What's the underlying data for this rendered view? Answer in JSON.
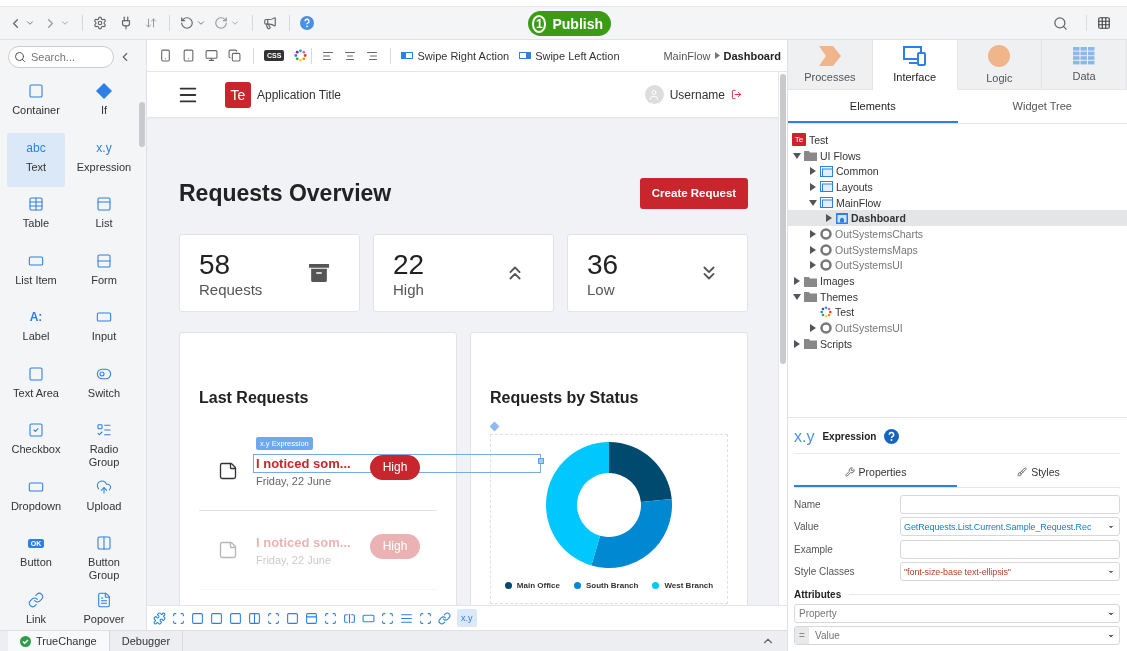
{
  "toolbar": {
    "publish": {
      "step": "1",
      "label": "Publish"
    }
  },
  "widgets": {
    "search": {
      "placeholder": "Search..."
    },
    "items": [
      {
        "label": "Container",
        "kind": "icon",
        "selected": false
      },
      {
        "label": "If",
        "kind": "icon",
        "selected": false
      },
      {
        "label": "Text",
        "kind": "glyph",
        "glyph": "abc",
        "selected": true
      },
      {
        "label": "Expression",
        "kind": "glyph",
        "glyph": "x.y",
        "selected": false
      },
      {
        "label": "Table",
        "kind": "icon",
        "selected": false
      },
      {
        "label": "List",
        "kind": "icon",
        "selected": false
      },
      {
        "label": "List Item",
        "kind": "icon",
        "selected": false
      },
      {
        "label": "Form",
        "kind": "icon",
        "selected": false
      },
      {
        "label": "Label",
        "kind": "glyph",
        "glyph": "A:",
        "selected": false
      },
      {
        "label": "Input",
        "kind": "icon",
        "selected": false
      },
      {
        "label": "Text Area",
        "kind": "icon",
        "selected": false
      },
      {
        "label": "Switch",
        "kind": "icon",
        "selected": false
      },
      {
        "label": "Checkbox",
        "kind": "icon",
        "selected": false
      },
      {
        "label": "Radio Group",
        "kind": "icon",
        "selected": false
      },
      {
        "label": "Dropdown",
        "kind": "icon",
        "selected": false
      },
      {
        "label": "Upload",
        "kind": "icon",
        "selected": false
      },
      {
        "label": "Button",
        "kind": "badge",
        "glyph": "OK",
        "selected": false
      },
      {
        "label": "Button Group",
        "kind": "icon",
        "selected": false
      },
      {
        "label": "Link",
        "kind": "icon",
        "selected": false
      },
      {
        "label": "Popover",
        "kind": "icon",
        "selected": false
      }
    ]
  },
  "canvas_toolbar": {
    "css_label": "CSS",
    "swipe_actions": [
      "Swipe Right Action",
      "Swipe Left Action"
    ],
    "breadcrumb": [
      "MainFlow",
      "Dashboard"
    ]
  },
  "preview": {
    "header": {
      "logo": "Te",
      "app_title": "Application Title",
      "username": "Username"
    },
    "title": "Requests Overview",
    "create_button": "Create Request",
    "stats": [
      {
        "value": "58",
        "label": "Requests"
      },
      {
        "value": "22",
        "label": "High"
      },
      {
        "value": "36",
        "label": "Low"
      }
    ],
    "last_requests": {
      "title": "Last Requests",
      "selection_tag": "x.y Expression",
      "items": [
        {
          "title": "I noticed som...",
          "date": "Friday, 22 June",
          "priority": "High",
          "selected": true,
          "dimmed": false
        },
        {
          "title": "I noticed som...",
          "date": "Friday, 22 June",
          "priority": "High",
          "selected": false,
          "dimmed": true
        }
      ]
    },
    "status_chart": {
      "title": "Requests by Status",
      "legend": [
        {
          "label": "Main Office",
          "color": "#004a70"
        },
        {
          "label": "South Branch",
          "color": "#0088d2"
        },
        {
          "label": "West Branch",
          "color": "#00c8ff"
        }
      ]
    }
  },
  "widget_bar": {
    "expression_label": "x.y",
    "expression_selected": true
  },
  "bottom_tabs": [
    {
      "label": "TrueChange",
      "selected": true
    },
    {
      "label": "Debugger",
      "selected": false
    }
  ],
  "right_panel": {
    "tabs": [
      {
        "label": "Processes",
        "selected": false
      },
      {
        "label": "Interface",
        "selected": true
      },
      {
        "label": "Logic",
        "selected": false
      },
      {
        "label": "Data",
        "selected": false
      }
    ],
    "subtabs": [
      {
        "label": "Elements",
        "selected": true
      },
      {
        "label": "Widget Tree",
        "selected": false
      }
    ],
    "tree": [
      {
        "label": "Test",
        "kind": "app",
        "badge": "Te",
        "toggle": false,
        "selected": false,
        "children": [
          {
            "label": "UI Flows",
            "kind": "folder",
            "toggle": true,
            "expanded": true,
            "selected": false,
            "children": [
              {
                "label": "Common",
                "kind": "flow",
                "toggle": true,
                "expanded": false,
                "selected": false
              },
              {
                "label": "Layouts",
                "kind": "flow",
                "toggle": true,
                "expanded": false,
                "selected": false
              },
              {
                "label": "MainFlow",
                "kind": "flow",
                "toggle": true,
                "expanded": true,
                "selected": false,
                "children": [
                  {
                    "label": "Dashboard",
                    "kind": "screen",
                    "toggle": true,
                    "expanded": false,
                    "selected": true
                  }
                ]
              },
              {
                "label": "OutSystemsCharts",
                "kind": "module",
                "toggle": true,
                "expanded": false,
                "selected": false
              },
              {
                "label": "OutSystemsMaps",
                "kind": "module",
                "toggle": true,
                "expanded": false,
                "selected": false
              },
              {
                "label": "OutSystemsUI",
                "kind": "module",
                "toggle": true,
                "expanded": false,
                "selected": false
              }
            ]
          },
          {
            "label": "Images",
            "kind": "folder",
            "toggle": true,
            "expanded": false,
            "selected": false
          },
          {
            "label": "Themes",
            "kind": "folder",
            "toggle": true,
            "expanded": true,
            "selected": false,
            "children": [
              {
                "label": "Test",
                "kind": "theme",
                "toggle": false,
                "selected": false
              },
              {
                "label": "OutSystemsUI",
                "kind": "module",
                "toggle": true,
                "expanded": false,
                "selected": false
              }
            ]
          },
          {
            "label": "Scripts",
            "kind": "folder",
            "toggle": true,
            "expanded": false,
            "selected": false
          }
        ]
      }
    ],
    "properties": {
      "glyph": "x.y",
      "title": "Expression",
      "tabs": [
        {
          "label": "Properties",
          "selected": true
        },
        {
          "label": "Styles",
          "selected": false
        }
      ],
      "fields": [
        {
          "label": "Name",
          "kind": "text"
        },
        {
          "label": "Value",
          "kind": "expression",
          "value": "GetRequests.List.Current.Sample_Request.Rec"
        },
        {
          "label": "Example",
          "kind": "text"
        },
        {
          "label": "Style Classes",
          "kind": "string",
          "value": "\"font-size-base text-ellipsis\""
        }
      ],
      "attributes": {
        "title": "Attributes",
        "property_placeholder": "Property",
        "operator": "=",
        "value_placeholder": "Value"
      }
    }
  }
}
